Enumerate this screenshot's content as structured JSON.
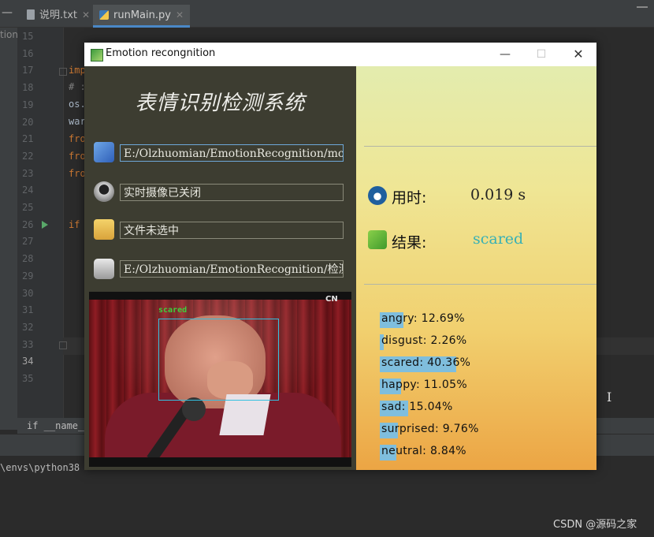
{
  "ide": {
    "tabs": [
      {
        "label": "说明.txt"
      },
      {
        "label": "runMain.py"
      }
    ],
    "left_panel_label": "tion",
    "line_numbers": [
      "15",
      "16",
      "17",
      "18",
      "19",
      "20",
      "21",
      "22",
      "23",
      "24",
      "25",
      "26",
      "27",
      "28",
      "29",
      "30",
      "31",
      "32",
      "33",
      "34",
      "35"
    ],
    "code_fragments": [
      "imp",
      "# :",
      "os.",
      "war",
      "fro",
      "fro",
      "fro",
      "if"
    ],
    "breadcrumb": "if __name__ =",
    "console_line": "\\envs\\python38"
  },
  "app": {
    "window_title": "Emotion recongnition",
    "heading": "表情识别检测系统",
    "model_path": "E:/Olzhuomian/EmotionRecognition/mod",
    "camera_status": "实时摄像已关闭",
    "file_status": "文件未选中",
    "image_path": "E:/Olzhuomian/EmotionRecognition/检测",
    "face_label": "scared",
    "video_logo": "CN",
    "time_label": "用时:",
    "time_value": "0.019  s",
    "result_label": "结果:",
    "result_value": "scared"
  },
  "probabilities": [
    {
      "label": "angry: 12.69%",
      "value": 12.69
    },
    {
      "label": "disgust: 2.26%",
      "value": 2.26
    },
    {
      "label": "scared: 40.36%",
      "value": 40.36
    },
    {
      "label": "happy: 11.05%",
      "value": 11.05
    },
    {
      "label": "sad: 15.04%",
      "value": 15.04
    },
    {
      "label": "surprised: 9.76%",
      "value": 9.76
    },
    {
      "label": "neutral: 8.84%",
      "value": 8.84
    }
  ],
  "watermark": "CSDN @源码之家",
  "colors": {
    "left_pane": "#3d3d31",
    "bar": "#7fbedd",
    "result_text": "#38b0b5"
  }
}
